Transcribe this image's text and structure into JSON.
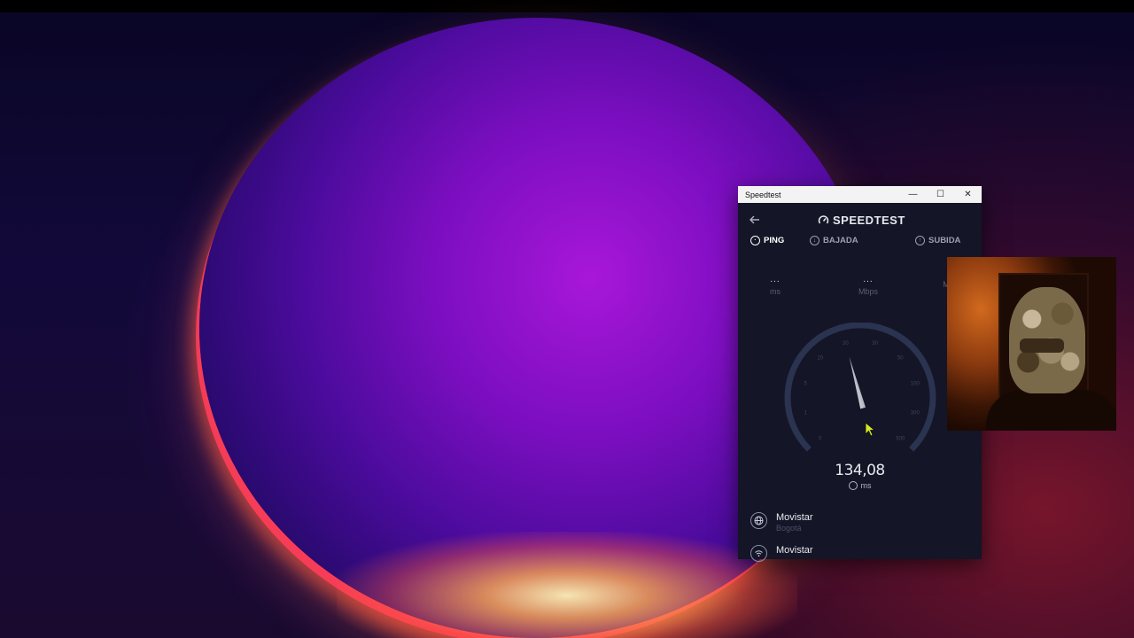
{
  "window": {
    "title": "Speedtest",
    "controls": {
      "minimize": "—",
      "maximize": "☐",
      "close": "✕"
    }
  },
  "app": {
    "brand": "SPEEDTEST",
    "back_icon": "arrow-left-icon",
    "tabs": [
      {
        "label": "PING",
        "icon": "ping-icon",
        "active": true
      },
      {
        "label": "BAJADA",
        "icon": "download-icon",
        "active": false
      },
      {
        "label": "SUBIDA",
        "icon": "upload-icon",
        "active": false
      }
    ],
    "metrics": [
      {
        "value": "...",
        "unit": "ms"
      },
      {
        "value": "...",
        "unit": "Mbps"
      },
      {
        "value": "",
        "unit": "M"
      }
    ],
    "gauge": {
      "ticks": [
        "0",
        "1",
        "5",
        "10",
        "20",
        "30",
        "50",
        "100",
        "300",
        "500"
      ],
      "needle_value": 20,
      "arc_color": "#2a3350"
    },
    "reading": {
      "value": "134,08",
      "unit": "ms"
    },
    "provider": {
      "name": "Movistar",
      "location": "Bogotá",
      "icon": "globe-icon"
    },
    "connection": {
      "name": "Movistar",
      "icon": "wifi-icon"
    }
  },
  "colors": {
    "window_bg": "#141526",
    "titlebar_bg": "#f3f3f3",
    "accent_text": "#ffffff",
    "muted_text": "#9aa0b6"
  }
}
